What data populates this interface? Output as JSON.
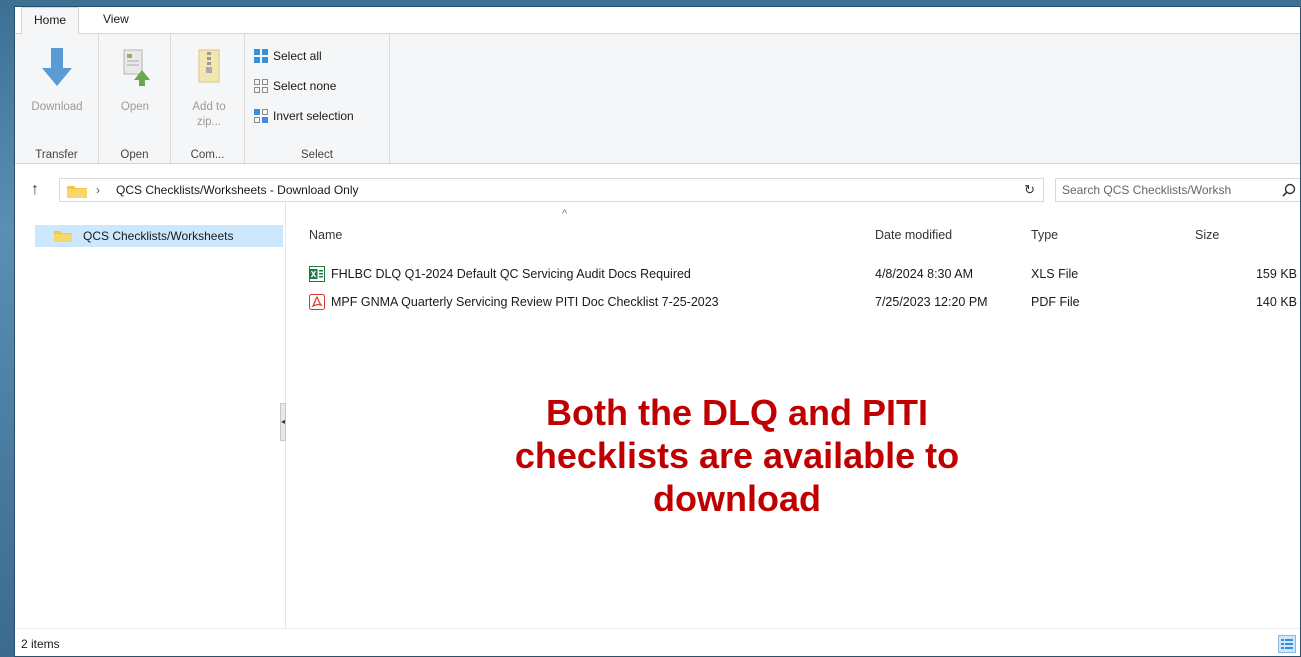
{
  "ribbon": {
    "tabs": [
      "Home",
      "View"
    ],
    "groups": {
      "transfer": {
        "label": "Transfer",
        "download_label": "Download"
      },
      "open": {
        "label": "Open",
        "open_label": "Open"
      },
      "compress": {
        "label": "Com...",
        "add_zip_line1": "Add to",
        "add_zip_line2": "zip..."
      },
      "select": {
        "label": "Select",
        "items": [
          "Select all",
          "Select none",
          "Invert selection"
        ]
      }
    }
  },
  "address": {
    "path": "QCS Checklists/Worksheets - Download Only",
    "search_placeholder": "Search QCS Checklists/Worksh"
  },
  "nav": {
    "items": [
      {
        "label": "QCS Checklists/Worksheets",
        "icon": "folder-icon"
      }
    ]
  },
  "list": {
    "sort_indicator": "^",
    "columns": [
      "Name",
      "Date modified",
      "Type",
      "Size"
    ],
    "rows": [
      {
        "name": "FHLBC DLQ Q1-2024 Default QC Servicing Audit Docs Required",
        "date": "4/8/2024 8:30 AM",
        "type": "XLS File",
        "size": "159 KB",
        "icon": "excel-icon"
      },
      {
        "name": "MPF GNMA Quarterly Servicing Review PITI Doc Checklist 7-25-2023",
        "date": "7/25/2023 12:20 PM",
        "type": "PDF File",
        "size": "140 KB",
        "icon": "pdf-icon"
      }
    ]
  },
  "callout": {
    "lines": [
      "Both the DLQ and PITI",
      "checklists are available to",
      "download"
    ],
    "color": "#c00000"
  },
  "status": {
    "count": "2 items"
  },
  "colors": {
    "selection": "#cce8ff",
    "accent": "#2f7fd1",
    "desktop": "#4a7ea3"
  }
}
